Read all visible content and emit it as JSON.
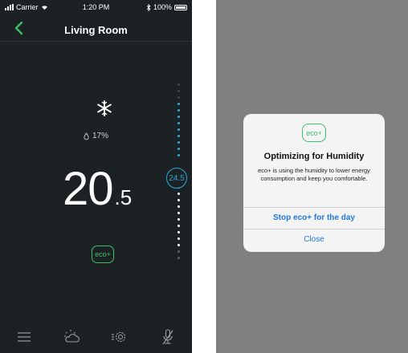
{
  "status_bar": {
    "carrier": "Carrier",
    "time": "1:20 PM",
    "battery": "100%"
  },
  "nav": {
    "title": "Living Room",
    "back_icon": "chevron-left-icon"
  },
  "thermostat": {
    "mode_icon": "snowflake-icon",
    "humidity": "17%",
    "temperature_main": "20",
    "temperature_decimal": ".5",
    "setpoint": "24.5",
    "eco_label": "eco+"
  },
  "tab_bar": {
    "items": [
      "menu-icon",
      "weather-icon",
      "settings-icon",
      "voice-icon"
    ]
  },
  "alert": {
    "badge": "eco+",
    "title": "Optimizing for Humidity",
    "message": "eco+ is using the humidity to lower energy consumption and keep you comfortable.",
    "primary_action": "Stop eco+ for the day",
    "secondary_action": "Close"
  },
  "colors": {
    "background_dark": "#1c2124",
    "accent_blue": "#2aa8e0",
    "eco_green": "#3fbf6a",
    "alert_link": "#1e7ae0",
    "overlay_gray": "#808080"
  }
}
